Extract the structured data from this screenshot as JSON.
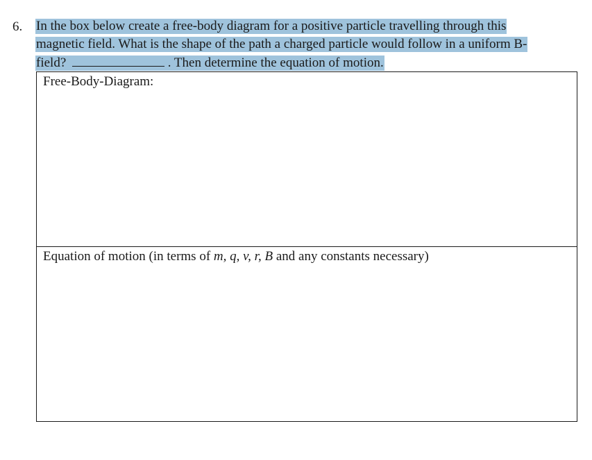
{
  "question": {
    "number": "6.",
    "line1": "In the box below create a free-body diagram for a positive particle travelling through this",
    "line2": "magnetic field.  What is the shape of the path a charged particle would follow in a uniform B-",
    "line3_before_blank": "field?",
    "line3_after_blank": ".  Then determine the equation of motion.",
    "highlight_color": "#9fc3dc"
  },
  "answer_box": {
    "fbd_label": "Free-Body-Diagram:",
    "eom_label_prefix": "Equation of motion  (in terms of ",
    "eom_vars": [
      "m,",
      "q,",
      "v,",
      "r,",
      "B"
    ],
    "eom_label_suffix": " and any constants necessary)"
  }
}
